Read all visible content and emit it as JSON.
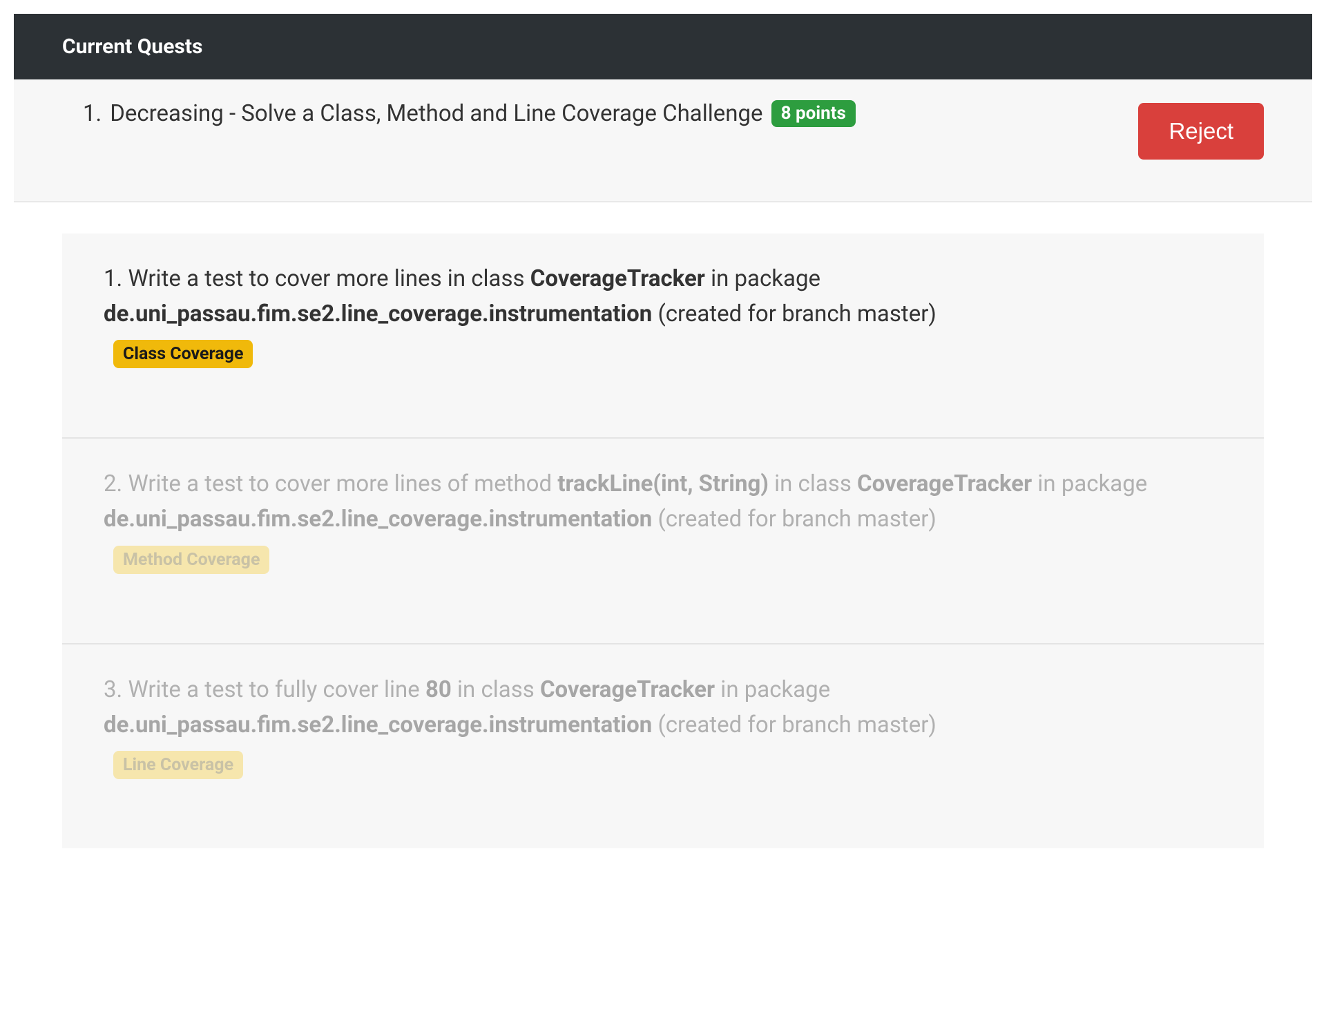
{
  "header": {
    "title": "Current Quests"
  },
  "quest": {
    "number": "1.",
    "title": "Decreasing - Solve a Class, Method and Line Coverage Challenge",
    "points_badge": "8 points",
    "reject_label": "Reject"
  },
  "tasks": [
    {
      "number": "1.",
      "prefix": "Write a test to cover more lines in class ",
      "class_name": "CoverageTracker",
      "mid1": " in package ",
      "package": "de.uni_passau.fim.se2.line_coverage.instrumentation",
      "suffix": " (created for branch master)",
      "badge": "Class Coverage",
      "disabled": false
    },
    {
      "number": "2.",
      "prefix": "Write a test to cover more lines of method ",
      "method_name": "trackLine(int, String)",
      "mid0": " in class ",
      "class_name": "CoverageTracker",
      "mid1": " in package ",
      "package": "de.uni_passau.fim.se2.line_coverage.instrumentation",
      "suffix": " (created for branch master)",
      "badge": "Method Coverage",
      "disabled": true
    },
    {
      "number": "3.",
      "prefix": "Write a test to fully cover line ",
      "line_number": "80",
      "mid0": " in class ",
      "class_name": "CoverageTracker",
      "mid1": " in package ",
      "package": "de.uni_passau.fim.se2.line_coverage.instrumentation",
      "suffix": " (created for branch master)",
      "badge": "Line Coverage",
      "disabled": true
    }
  ]
}
